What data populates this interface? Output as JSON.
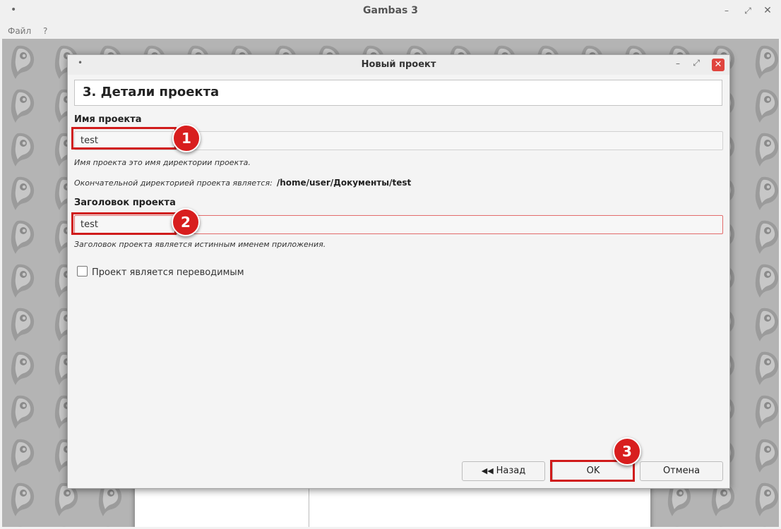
{
  "window": {
    "title": "Gambas 3",
    "menu": [
      "Файл",
      "?"
    ]
  },
  "dialog": {
    "title": "Новый проект",
    "step_title": "3. Детали проекта",
    "project_name": {
      "label": "Имя проекта",
      "value": "test",
      "hint": "Имя проекта это имя директории проекта."
    },
    "final_dir": {
      "label": "Окончательной директорией проекта является:",
      "path": "/home/user/Документы/test"
    },
    "project_title": {
      "label": "Заголовок проекта",
      "value": "test",
      "hint": "Заголовок проекта является истинным именем приложения."
    },
    "translatable_checkbox": {
      "label": "Проект является переводимым",
      "checked": false
    },
    "buttons": {
      "back": "Назад",
      "ok": "OK",
      "cancel": "Отмена"
    }
  },
  "annotations": [
    "1",
    "2",
    "3"
  ],
  "colors": {
    "annotation_red": "#d81e1e",
    "close_button": "#e0443e",
    "error_border": "#e26b6b",
    "workspace_bg": "#b4b4b4"
  }
}
